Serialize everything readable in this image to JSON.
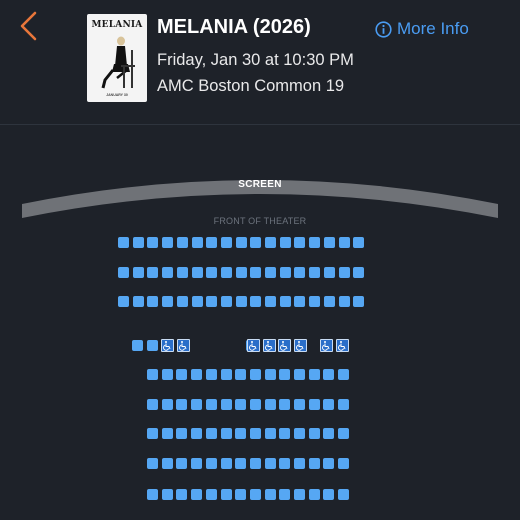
{
  "header": {
    "movie_title": "MELANIA (2026)",
    "showtime": "Friday, Jan 30 at 10:30 PM",
    "theater": "AMC Boston Common 19",
    "more_info_label": "More Info",
    "poster": {
      "title": "MELANIA",
      "date": "JANUARY 30"
    }
  },
  "seat_map": {
    "screen_label": "SCREEN",
    "front_label": "FRONT OF THEATER",
    "seat_color": "#56a7f3",
    "accessible_color": "#2a6ec9"
  },
  "colors": {
    "accent": "#e86a2c",
    "link": "#4a9cf2",
    "background": "#1e2229"
  }
}
